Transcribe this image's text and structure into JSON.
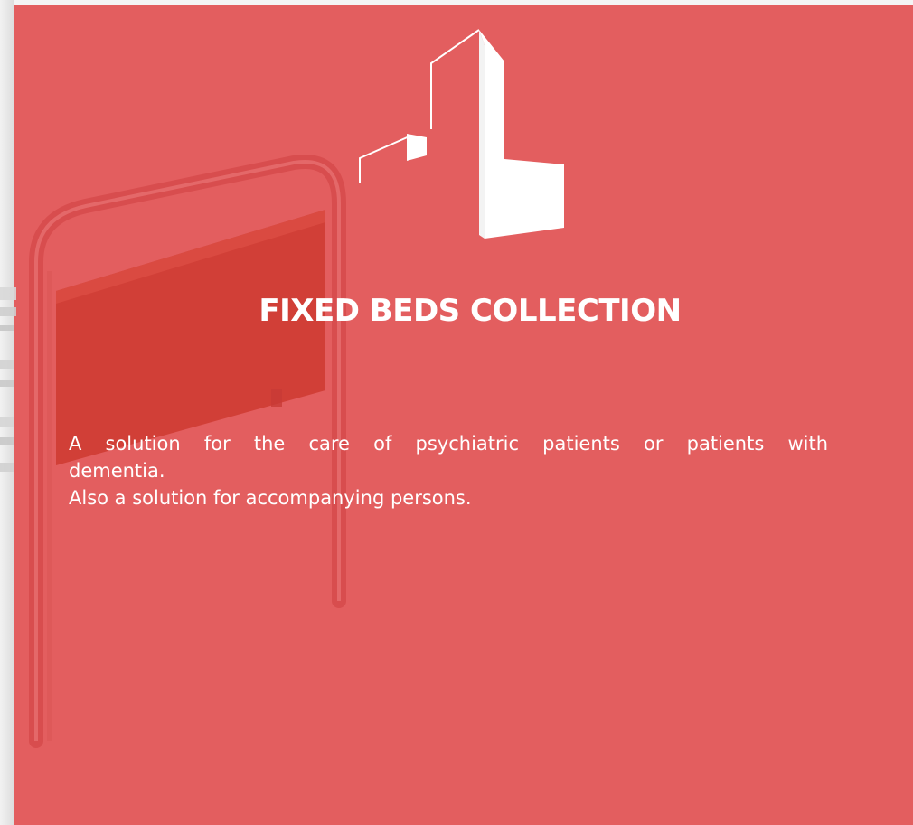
{
  "document": {
    "title": "FIXED BEDS COLLECTION",
    "description": {
      "line1": "A solution for the care of psychiatric patients or patients with",
      "line2": "dementia.",
      "line3": "Also a solution for accompanying persons."
    }
  },
  "colors": {
    "panel_background": "#e35e5f",
    "headboard_red": "#d13f37",
    "text": "#ffffff"
  },
  "icons": {
    "logo": "city-buildings-logo",
    "background_image": "bed-headboard-image"
  }
}
